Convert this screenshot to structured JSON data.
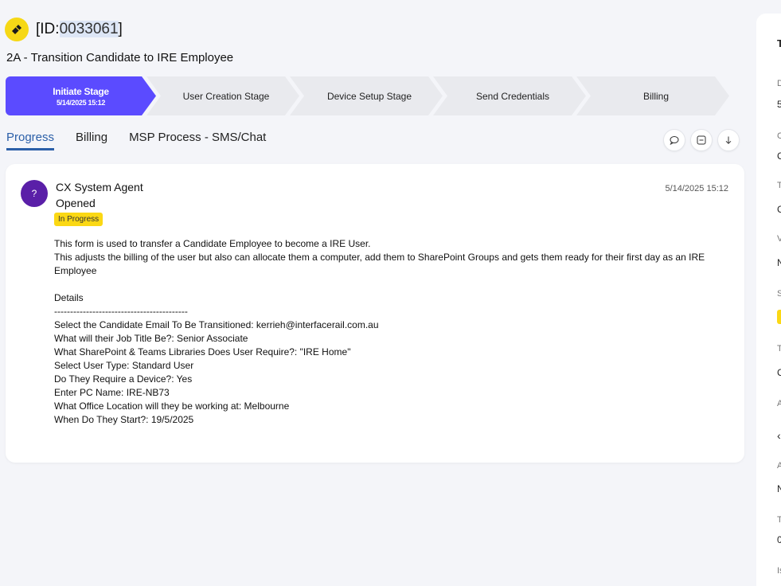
{
  "ticket": {
    "id_prefix": "[ID:",
    "id_number": "0033061",
    "id_suffix": "]",
    "subtitle": "2A - Transition Candidate to IRE Employee"
  },
  "stages": [
    {
      "name": "Initiate Stage",
      "date": "5/14/2025 15:12",
      "active": true
    },
    {
      "name": "User Creation Stage",
      "date": "",
      "active": false
    },
    {
      "name": "Device Setup Stage",
      "date": "",
      "active": false
    },
    {
      "name": "Send Credentials",
      "date": "",
      "active": false
    },
    {
      "name": "Billing",
      "date": "",
      "active": false
    }
  ],
  "tabs": [
    {
      "label": "Progress",
      "active": true
    },
    {
      "label": "Billing",
      "active": false
    },
    {
      "label": "MSP Process - SMS/Chat",
      "active": false
    }
  ],
  "toolbar": {
    "icons": [
      "comment-icon",
      "collapse-icon",
      "download-icon"
    ]
  },
  "activity": {
    "avatar_initial": "?",
    "author": "CX System Agent",
    "action": "Opened",
    "status": "In Progress",
    "timestamp": "5/14/2025 15:12",
    "body": "This form is used to transfer a Candidate Employee to become a IRE User.\nThis adjusts the billing of the user but also can allocate them a computer, add them to SharePoint Groups and gets them ready for their first day as an IRE Employee\n\nDetails\n------------------------------------------\nSelect the Candidate Email To Be Transitioned: kerrieh@interfacerail.com.au\nWhat will their Job Title Be?: Senior Associate\nWhat SharePoint & Teams Libraries Does User Require?: \"IRE Home\"\nSelect User Type: Standard User\nDo They Require a Device?: Yes\nEnter PC Name: IRE-NB73\nWhat Office Location will they be working at: Melbourne\nWhen Do They Start?: 19/5/2025"
  },
  "right_panel": {
    "header": "T",
    "labels": [
      "D",
      "C",
      "T",
      "V",
      "S",
      "T",
      "A",
      "A",
      "T",
      "Is"
    ],
    "values": [
      "5",
      "C",
      "C",
      "N",
      "",
      "C",
      "‹",
      "N",
      "0",
      ""
    ]
  },
  "colors": {
    "accent": "#5b4bff",
    "tab_active": "#2b5fa8",
    "badge": "#fbd814",
    "avatar": "#5a1fa8",
    "ticket_icon": "#f6d816"
  }
}
